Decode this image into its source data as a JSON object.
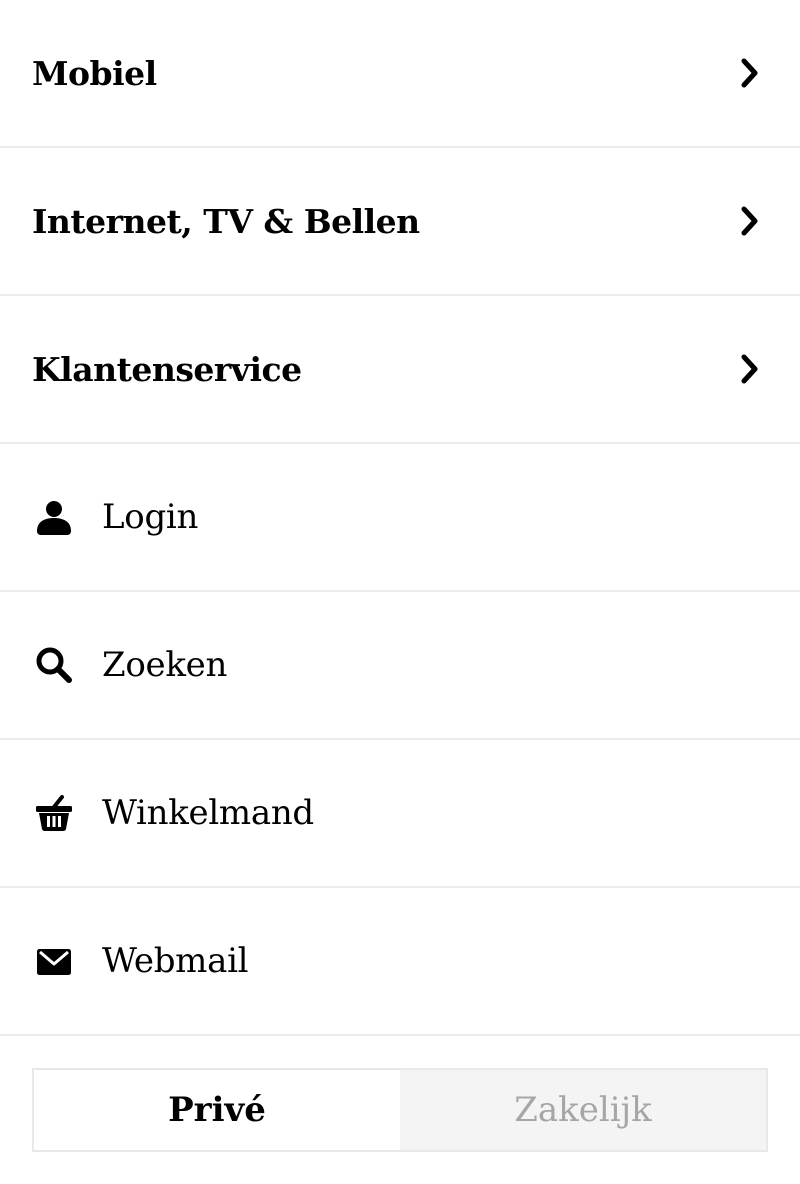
{
  "menu": {
    "nav_items": [
      {
        "label": "Mobiel",
        "icon": "chevron-right-icon"
      },
      {
        "label": "Internet, TV & Bellen",
        "icon": "chevron-right-icon"
      },
      {
        "label": "Klantenservice",
        "icon": "chevron-right-icon"
      }
    ],
    "actions": [
      {
        "label": "Login",
        "icon": "user-icon"
      },
      {
        "label": "Zoeken",
        "icon": "search-icon"
      },
      {
        "label": "Winkelmand",
        "icon": "basket-icon"
      },
      {
        "label": "Webmail",
        "icon": "mail-icon"
      }
    ]
  },
  "segment": {
    "options": [
      "Privé",
      "Zakelijk"
    ],
    "selected": "Privé"
  },
  "colors": {
    "text": "#000000",
    "divider": "#ececec",
    "inactive_text": "#a6a6a6",
    "inactive_bg": "#f4f4f4"
  }
}
